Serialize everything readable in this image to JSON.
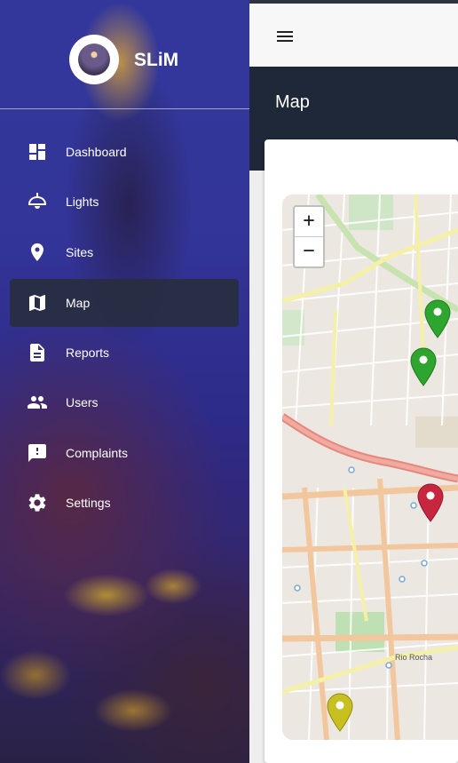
{
  "app": {
    "name": "SLiM"
  },
  "sidebar": {
    "items": [
      {
        "label": "Dashboard",
        "icon": "dashboard-icon"
      },
      {
        "label": "Lights",
        "icon": "lamp-icon"
      },
      {
        "label": "Sites",
        "icon": "location-pin-icon"
      },
      {
        "label": "Map",
        "icon": "map-icon",
        "active": true
      },
      {
        "label": "Reports",
        "icon": "document-icon"
      },
      {
        "label": "Users",
        "icon": "users-icon"
      },
      {
        "label": "Complaints",
        "icon": "feedback-icon"
      },
      {
        "label": "Settings",
        "icon": "gear-icon"
      }
    ]
  },
  "topbar": {
    "menu_icon": "hamburger-menu-icon"
  },
  "header": {
    "title": "Map"
  },
  "map": {
    "zoom_in_label": "+",
    "zoom_out_label": "−",
    "street_label": "Rio Rocha",
    "markers": [
      {
        "color": "green",
        "hex": "#2ea52e"
      },
      {
        "color": "green",
        "hex": "#2ea52e"
      },
      {
        "color": "red",
        "hex": "#c8263f"
      },
      {
        "color": "yellow",
        "hex": "#c8c020"
      }
    ]
  },
  "colors": {
    "sidebar_active_bg": "#2b303c",
    "header_bg": "#1f2838",
    "topbar_bg": "#f7f7f7"
  }
}
